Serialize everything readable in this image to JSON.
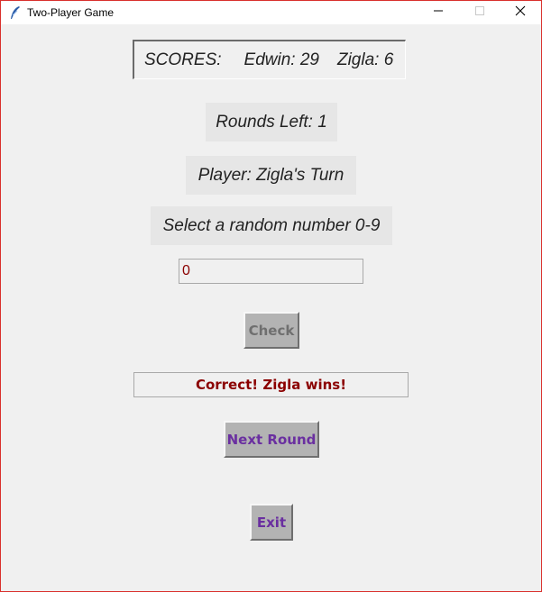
{
  "window": {
    "title": "Two-Player Game",
    "icons": {
      "app": "feather-icon",
      "minimize": "minimize-icon",
      "maximize": "maximize-icon",
      "close": "close-icon"
    }
  },
  "scores": {
    "label": "SCORES:",
    "player1": "Edwin: 29",
    "player2": "Zigla: 6"
  },
  "rounds_label": "Rounds Left: 1",
  "player_label": "Player: Zigla's Turn",
  "prompt_label": "Select a random number 0-9",
  "guess_input": {
    "value": "0"
  },
  "buttons": {
    "check": "Check",
    "next_round": "Next Round",
    "exit": "Exit"
  },
  "result_text": "Correct! Zigla wins!",
  "colors": {
    "window_border": "#d9302c",
    "background": "#f0f0f0",
    "result_text": "#8b0000",
    "button_text": "#6a2fa0",
    "disabled_text": "#6f6f6f"
  }
}
